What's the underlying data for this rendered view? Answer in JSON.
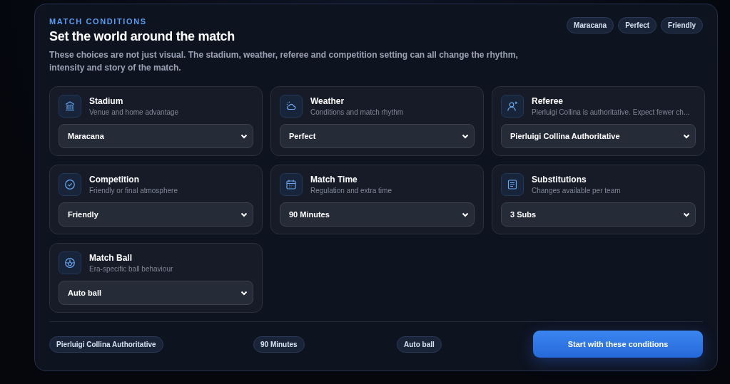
{
  "header": {
    "eyebrow": "MATCH CONDITIONS",
    "title": "Set the world around the match",
    "description": "These choices are not just visual. The stadium, weather, referee and competition setting can all change the rhythm, intensity and story of the match."
  },
  "summary_chips": [
    "Maracana",
    "Perfect",
    "Friendly"
  ],
  "settings": [
    {
      "kind": "stadium",
      "title": "Stadium",
      "subtitle": "Venue and home advantage",
      "value": "Maracana"
    },
    {
      "kind": "weather",
      "title": "Weather",
      "subtitle": "Conditions and match rhythm",
      "value": "Perfect"
    },
    {
      "kind": "referee",
      "title": "Referee",
      "subtitle": "Pierluigi Collina is authoritative. Expect fewer ch...",
      "value": "Pierluigi Collina Authoritative"
    },
    {
      "kind": "competition",
      "title": "Competition",
      "subtitle": "Friendly or final atmosphere",
      "value": "Friendly"
    },
    {
      "kind": "time",
      "title": "Match Time",
      "subtitle": "Regulation and extra time",
      "value": "90 Minutes"
    },
    {
      "kind": "substitutions",
      "title": "Substitutions",
      "subtitle": "Changes available per team",
      "value": "3 Subs"
    },
    {
      "kind": "ball",
      "title": "Match Ball",
      "subtitle": "Era-specific ball behaviour",
      "value": "Auto ball"
    }
  ],
  "footer_chips": [
    "Pierluigi Collina Authoritative",
    "90 Minutes",
    "Auto ball"
  ],
  "start_button": "Start with these conditions"
}
